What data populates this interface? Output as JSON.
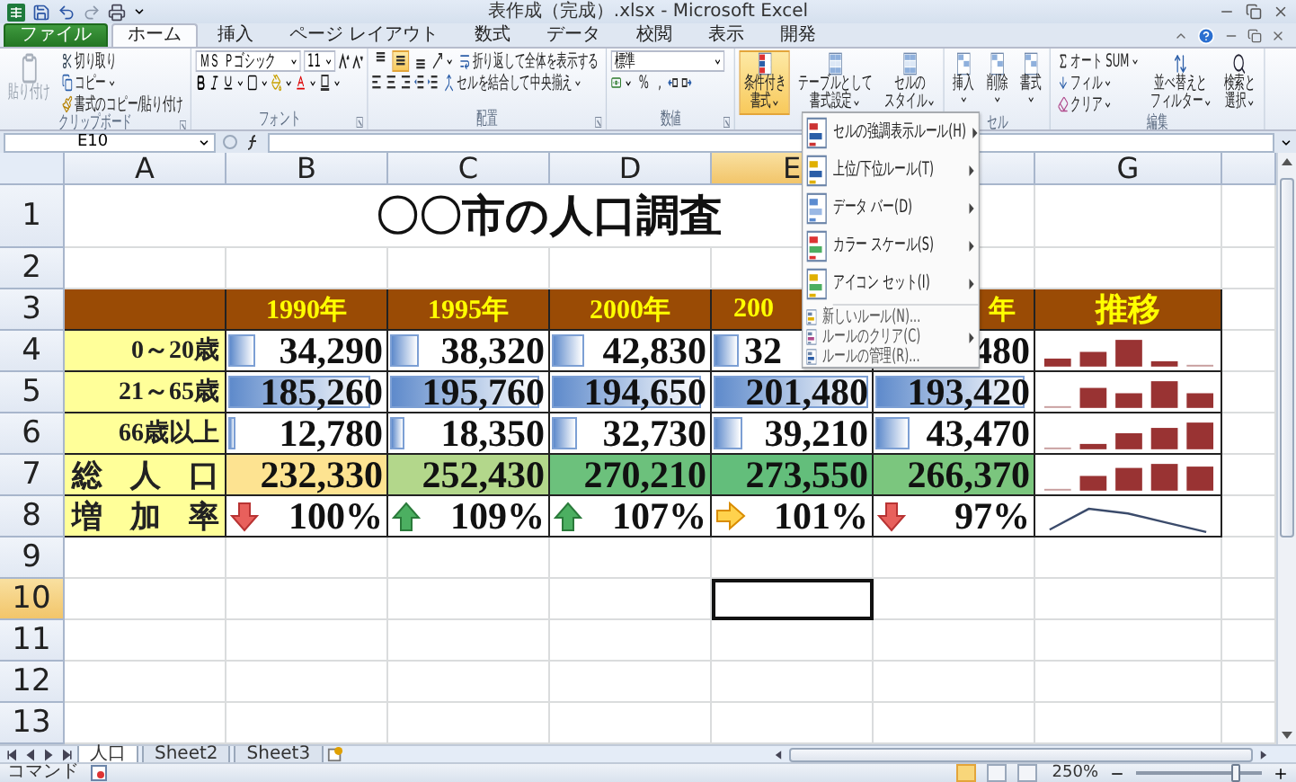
{
  "window": {
    "title": "表作成（完成）.xlsx - Microsoft Excel"
  },
  "ribbon_tabs": [
    {
      "label": "ファイル",
      "kind": "file",
      "selected": false
    },
    {
      "label": "ホーム",
      "kind": "tab",
      "selected": true
    },
    {
      "label": "挿入",
      "kind": "tab",
      "selected": false
    },
    {
      "label": "ページ レイアウト",
      "kind": "tab",
      "selected": false
    },
    {
      "label": "数式",
      "kind": "tab",
      "selected": false
    },
    {
      "label": "データ",
      "kind": "tab",
      "selected": false
    },
    {
      "label": "校閲",
      "kind": "tab",
      "selected": false
    },
    {
      "label": "表示",
      "kind": "tab",
      "selected": false
    },
    {
      "label": "開発",
      "kind": "tab",
      "selected": false
    }
  ],
  "ribbon": {
    "clipboard": {
      "label": "クリップボード",
      "paste": {
        "label": "貼り付け",
        "disabled": true
      },
      "cut": "切り取り",
      "copy": "コピー",
      "format_painter": "書式のコピー/貼り付け"
    },
    "font": {
      "label": "フォント",
      "font_name": "ＭＳ Ｐゴシック",
      "font_size": "11"
    },
    "alignment": {
      "label": "配置",
      "vertical": [
        {
          "selected": false
        },
        {
          "selected": true
        },
        {
          "selected": false
        }
      ],
      "wrap_text": "折り返して全体を表示する",
      "merge_center": "セルを結合して中央揃え"
    },
    "number": {
      "label": "数値",
      "format": "標準",
      "percent": "%",
      "comma": ","
    },
    "styles": [
      {
        "lines": [
          "条件付き",
          "書式"
        ],
        "selected": true
      },
      {
        "lines": [
          "テーブルとして",
          "書式設定"
        ],
        "selected": false
      },
      {
        "lines": [
          "セルの",
          "スタイル"
        ],
        "selected": false
      }
    ],
    "cells": {
      "label": "セル",
      "buttons": [
        "挿入",
        "削除",
        "書式"
      ]
    },
    "editing": {
      "label": "編集",
      "autosum": "オート SUM",
      "fill": "フィル",
      "clear": "クリア",
      "sort": [
        "並べ替えと",
        "フィルター"
      ],
      "find": [
        "検索と",
        "選択"
      ]
    }
  },
  "formula_bar": {
    "name_box": "E10"
  },
  "columns": [
    {
      "label": "A",
      "selected": false
    },
    {
      "label": "B",
      "selected": false
    },
    {
      "label": "C",
      "selected": false
    },
    {
      "label": "D",
      "selected": false
    },
    {
      "label": "E",
      "selected": true
    },
    {
      "label": "G",
      "selected": false
    }
  ],
  "rows": [
    {
      "label": "1",
      "selected": false
    },
    {
      "label": "2",
      "selected": false
    },
    {
      "label": "3",
      "selected": false
    },
    {
      "label": "4",
      "selected": false
    },
    {
      "label": "5",
      "selected": false
    },
    {
      "label": "6",
      "selected": false
    },
    {
      "label": "7",
      "selected": false
    },
    {
      "label": "8",
      "selected": false
    },
    {
      "label": "9",
      "selected": false
    },
    {
      "label": "10",
      "selected": true
    },
    {
      "label": "11",
      "selected": false
    },
    {
      "label": "12",
      "selected": false
    },
    {
      "label": "13",
      "selected": false
    }
  ],
  "title": "〇〇市の人口調査",
  "table": {
    "header": [
      {
        "text": "1990年"
      },
      {
        "text": "1995年"
      },
      {
        "text": "2000年"
      },
      {
        "text": "200",
        "cut_end": true
      },
      {
        "text": "年",
        "cut_start": true
      },
      {
        "text": "推移"
      }
    ],
    "rows": [
      {
        "label": "0～20歳",
        "kind": "data_bar",
        "cells": [
          {
            "value": "34,290",
            "level": 0.17
          },
          {
            "value": "38,320",
            "level": 0.19
          },
          {
            "value": "42,830",
            "level": 0.21
          },
          {
            "value": "32",
            "cut_end": true,
            "level": 0.16
          },
          {
            "value": "480",
            "cut_start": true
          }
        ]
      },
      {
        "label": "21～65歳",
        "kind": "data_bar",
        "cells": [
          {
            "value": "185,260",
            "level": 0.92
          },
          {
            "value": "195,760",
            "level": 0.97
          },
          {
            "value": "194,650",
            "level": 0.96
          },
          {
            "value": "201,480",
            "level": 1.0
          },
          {
            "value": "193,420",
            "level": 0.96
          }
        ]
      },
      {
        "label": "66歳以上",
        "kind": "data_bar",
        "cells": [
          {
            "value": "12,780",
            "level": 0.05
          },
          {
            "value": "18,350",
            "level": 0.09
          },
          {
            "value": "32,730",
            "level": 0.16
          },
          {
            "value": "39,210",
            "level": 0.19
          },
          {
            "value": "43,470",
            "level": 0.22
          }
        ]
      },
      {
        "label": "総人口",
        "kind": "color_scale",
        "cells": [
          {
            "value": "232,330",
            "color": "#fde391"
          },
          {
            "value": "252,430",
            "color": "#b3d78b"
          },
          {
            "value": "270,210",
            "color": "#6cc17c"
          },
          {
            "value": "273,550",
            "color": "#63be7b"
          },
          {
            "value": "266,370",
            "color": "#7bc67e"
          }
        ]
      },
      {
        "label": "増加率",
        "kind": "icon_set",
        "cells": [
          {
            "value": "100%",
            "kind": "down"
          },
          {
            "value": "109%",
            "kind": "up"
          },
          {
            "value": "107%",
            "kind": "up"
          },
          {
            "value": "101%",
            "kind": "right"
          },
          {
            "value": "97%",
            "kind": "down"
          }
        ]
      }
    ]
  },
  "menu": {
    "items": [
      {
        "label": "セルの強調表示ルール(H)",
        "kind": "large",
        "submenu": true
      },
      {
        "label": "上位/下位ルール(T)",
        "kind": "large",
        "submenu": true
      },
      {
        "label": "データ バー(D)",
        "kind": "large",
        "submenu": true
      },
      {
        "label": "カラー スケール(S)",
        "kind": "large",
        "submenu": true
      },
      {
        "label": "アイコン セット(I)",
        "kind": "large",
        "submenu": true
      },
      {
        "label": "新しいルール(N)...",
        "kind": "small",
        "submenu": false
      },
      {
        "label": "ルールのクリア(C)",
        "kind": "small",
        "submenu": true
      },
      {
        "label": "ルールの管理(R)...",
        "kind": "small",
        "submenu": false
      }
    ]
  },
  "sheet_tabs": [
    {
      "label": "人口",
      "selected": true
    },
    {
      "label": "Sheet2",
      "selected": false
    },
    {
      "label": "Sheet3",
      "selected": false
    }
  ],
  "status_bar": {
    "mode": "コマンド",
    "views": [
      {
        "selected": true
      },
      {
        "selected": false
      },
      {
        "selected": false
      }
    ],
    "zoom": "250%",
    "zoom_slider": {
      "level": 0.82
    }
  }
}
